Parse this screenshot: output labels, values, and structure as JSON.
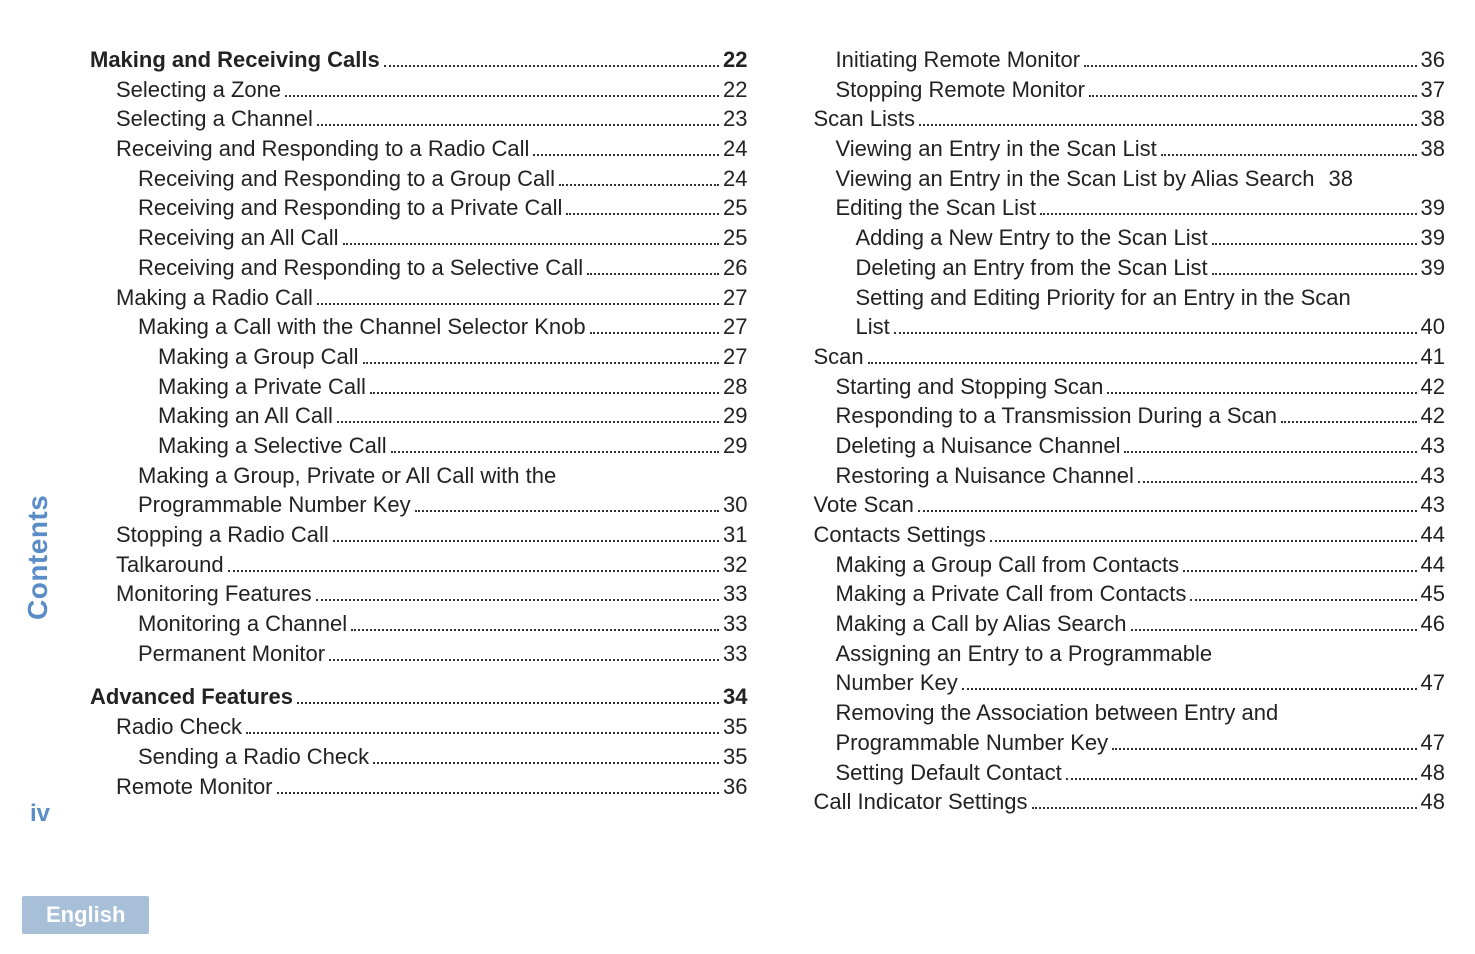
{
  "sidebar": {
    "label": "Contents",
    "page_number": "iv",
    "language": "English"
  },
  "columns": [
    [
      {
        "text": "Making and Receiving Calls",
        "page": "22",
        "indent": 0,
        "bold": true
      },
      {
        "text": "Selecting a Zone",
        "page": "22",
        "indent": 1
      },
      {
        "text": "Selecting a Channel",
        "page": "23",
        "indent": 1
      },
      {
        "text": "Receiving and Responding to a Radio Call",
        "page": "24",
        "indent": 1
      },
      {
        "text": "Receiving and Responding to a Group Call",
        "page": "24",
        "indent": 2
      },
      {
        "text": "Receiving and Responding to a Private Call",
        "page": "25",
        "indent": 2
      },
      {
        "text": "Receiving an All Call",
        "page": "25",
        "indent": 2
      },
      {
        "text": "Receiving and Responding to a Selective Call",
        "page": "26",
        "indent": 2
      },
      {
        "text": "Making a Radio Call",
        "page": "27",
        "indent": 1
      },
      {
        "text": "Making a Call with the Channel Selector Knob",
        "page": "27",
        "indent": 2
      },
      {
        "text": "Making a Group Call",
        "page": "27",
        "indent": 3
      },
      {
        "text": "Making a Private Call",
        "page": "28",
        "indent": 3
      },
      {
        "text": "Making an All Call",
        "page": "29",
        "indent": 3
      },
      {
        "text": "Making a Selective Call",
        "page": "29",
        "indent": 3
      },
      {
        "text": "Making a Group, Private or All Call with the",
        "page": "",
        "indent": 2,
        "no_dots": true
      },
      {
        "text": "Programmable Number Key",
        "page": "30",
        "indent": 2
      },
      {
        "text": "Stopping a Radio Call",
        "page": "31",
        "indent": 1
      },
      {
        "text": "Talkaround",
        "page": "32",
        "indent": 1
      },
      {
        "text": "Monitoring Features",
        "page": "33",
        "indent": 1
      },
      {
        "text": "Monitoring a Channel",
        "page": "33",
        "indent": 2
      },
      {
        "text": "Permanent Monitor",
        "page": "33",
        "indent": 2
      },
      {
        "text": "Advanced Features",
        "page": "34",
        "indent": 0,
        "bold": true,
        "gap_before": true
      },
      {
        "text": "Radio Check",
        "page": "35",
        "indent": 1
      },
      {
        "text": "Sending a Radio Check",
        "page": "35",
        "indent": 2
      },
      {
        "text": "Remote Monitor",
        "page": "36",
        "indent": 1
      }
    ],
    [
      {
        "text": "Initiating Remote Monitor",
        "page": "36",
        "indent": 2
      },
      {
        "text": "Stopping Remote Monitor",
        "page": "37",
        "indent": 2
      },
      {
        "text": "Scan Lists",
        "page": "38",
        "indent": 1
      },
      {
        "text": "Viewing an Entry in the Scan List",
        "page": "38",
        "indent": 2
      },
      {
        "text": "Viewing an Entry in the Scan List by Alias Search",
        "page": "38",
        "indent": 2,
        "tight": true
      },
      {
        "text": "Editing the Scan List",
        "page": "39",
        "indent": 2
      },
      {
        "text": "Adding a New Entry to the Scan List",
        "page": "39",
        "indent": 3
      },
      {
        "text": "Deleting an Entry from the Scan List",
        "page": "39",
        "indent": 3
      },
      {
        "text": "Setting and Editing Priority for an Entry in the Scan",
        "page": "",
        "indent": 3,
        "no_dots": true
      },
      {
        "text": "List",
        "page": "40",
        "indent": 3
      },
      {
        "text": "Scan",
        "page": "41",
        "indent": 1
      },
      {
        "text": "Starting and Stopping Scan",
        "page": "42",
        "indent": 2
      },
      {
        "text": "Responding to a Transmission During a Scan",
        "page": "42",
        "indent": 2
      },
      {
        "text": "Deleting a Nuisance Channel",
        "page": "43",
        "indent": 2
      },
      {
        "text": "Restoring a Nuisance Channel",
        "page": "43",
        "indent": 2
      },
      {
        "text": "Vote Scan",
        "page": "43",
        "indent": 1
      },
      {
        "text": "Contacts Settings",
        "page": "44",
        "indent": 1
      },
      {
        "text": "Making a Group Call from Contacts",
        "page": "44",
        "indent": 2
      },
      {
        "text": "Making a Private Call from Contacts",
        "page": "45",
        "indent": 2
      },
      {
        "text": "Making a Call by Alias Search",
        "page": "46",
        "indent": 2
      },
      {
        "text": "Assigning an Entry to a Programmable",
        "page": "",
        "indent": 2,
        "no_dots": true
      },
      {
        "text": "Number Key",
        "page": "47",
        "indent": 2
      },
      {
        "text": "Removing the Association between Entry and",
        "page": "",
        "indent": 2,
        "no_dots": true
      },
      {
        "text": "Programmable Number Key",
        "page": "47",
        "indent": 2
      },
      {
        "text": "Setting Default Contact",
        "page": "48",
        "indent": 2
      },
      {
        "text": "Call Indicator Settings",
        "page": "48",
        "indent": 1
      }
    ]
  ]
}
